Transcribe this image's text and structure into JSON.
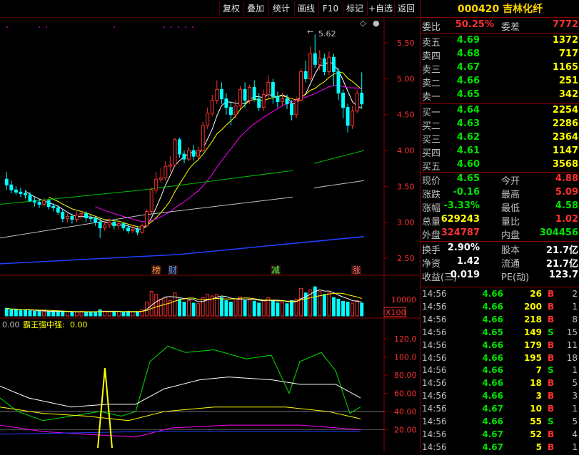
{
  "toolbar": {
    "buttons": [
      "复权",
      "叠加",
      "统计",
      "画线",
      "F10",
      "标记",
      "+自选",
      "返回"
    ]
  },
  "stock": {
    "code": "000420",
    "name": "吉林化纤"
  },
  "price_axis": [
    "5.50",
    "5.00",
    "4.50",
    "4.00",
    "3.50",
    "3.00",
    "2.50"
  ],
  "peak_label": "5.62",
  "event_markers": [
    "榜",
    "财",
    "减",
    "涨"
  ],
  "volume_axis": {
    "label": "10000",
    "unit": "X100"
  },
  "indicator": {
    "value_left": "0.00",
    "name": "霸王强中强:",
    "value": "0.00",
    "axis": [
      "120.0",
      "100.0",
      "80.00",
      "60.00",
      "40.00",
      "20.00"
    ]
  },
  "quote": {
    "weibi": {
      "label": "委比",
      "value": "50.25%",
      "label2": "委差",
      "value2": "7772"
    },
    "sell": [
      {
        "label": "卖五",
        "price": "4.69",
        "vol": "1372"
      },
      {
        "label": "卖四",
        "price": "4.68",
        "vol": "717"
      },
      {
        "label": "卖三",
        "price": "4.67",
        "vol": "1165"
      },
      {
        "label": "卖二",
        "price": "4.66",
        "vol": "251"
      },
      {
        "label": "卖一",
        "price": "4.65",
        "vol": "342"
      }
    ],
    "buy": [
      {
        "label": "买一",
        "price": "4.64",
        "vol": "2254"
      },
      {
        "label": "买二",
        "price": "4.63",
        "vol": "2286"
      },
      {
        "label": "买三",
        "price": "4.62",
        "vol": "2364"
      },
      {
        "label": "买四",
        "price": "4.61",
        "vol": "1147"
      },
      {
        "label": "买五",
        "price": "4.60",
        "vol": "3568"
      }
    ],
    "stats": [
      {
        "l1": "现价",
        "v1": "4.65",
        "c1": "green",
        "l2": "今开",
        "v2": "4.88",
        "c2": "red"
      },
      {
        "l1": "涨跌",
        "v1": "-0.16",
        "c1": "green",
        "l2": "最高",
        "v2": "5.09",
        "c2": "red"
      },
      {
        "l1": "涨幅",
        "v1": "-3.33%",
        "c1": "green",
        "l2": "最低",
        "v2": "4.58",
        "c2": "green"
      },
      {
        "l1": "总量",
        "v1": "629243",
        "c1": "yellow",
        "l2": "量比",
        "v2": "1.02",
        "c2": "red"
      },
      {
        "l1": "外盘",
        "v1": "324787",
        "c1": "red",
        "l2": "内盘",
        "v2": "304456",
        "c2": "green"
      }
    ],
    "stats2": [
      {
        "l1": "换手",
        "v1": "2.90%",
        "l2": "股本",
        "v2": "21.7亿"
      },
      {
        "l1": "净资",
        "v1": "1.42",
        "l2": "流通",
        "v2": "21.7亿"
      },
      {
        "l1": "收益(三)",
        "v1": "0.019",
        "l2": "PE(动)",
        "v2": "123.7"
      }
    ]
  },
  "trades": [
    {
      "time": "14:56",
      "price": "4.66",
      "vol": "26",
      "bs": "B",
      "n": "2"
    },
    {
      "time": "14:56",
      "price": "4.66",
      "vol": "200",
      "bs": "B",
      "n": "1"
    },
    {
      "time": "14:56",
      "price": "4.66",
      "vol": "218",
      "bs": "B",
      "n": "8"
    },
    {
      "time": "14:56",
      "price": "4.65",
      "vol": "149",
      "bs": "S",
      "n": "15"
    },
    {
      "time": "14:56",
      "price": "4.66",
      "vol": "179",
      "bs": "B",
      "n": "11"
    },
    {
      "time": "14:56",
      "price": "4.66",
      "vol": "195",
      "bs": "B",
      "n": "18"
    },
    {
      "time": "14:56",
      "price": "4.66",
      "vol": "7",
      "bs": "S",
      "n": "1"
    },
    {
      "time": "14:56",
      "price": "4.66",
      "vol": "18",
      "bs": "B",
      "n": "5"
    },
    {
      "time": "14:56",
      "price": "4.66",
      "vol": "3",
      "bs": "B",
      "n": "3"
    },
    {
      "time": "14:56",
      "price": "4.67",
      "vol": "10",
      "bs": "B",
      "n": "1"
    },
    {
      "time": "14:56",
      "price": "4.66",
      "vol": "55",
      "bs": "S",
      "n": "5"
    },
    {
      "time": "14:56",
      "price": "4.67",
      "vol": "52",
      "bs": "B",
      "n": "4"
    },
    {
      "time": "14:56",
      "price": "4.67",
      "vol": "5",
      "bs": "B",
      "n": "1"
    }
  ],
  "chart_data": {
    "type": "candlestick",
    "ylim": [
      2.3,
      5.8
    ],
    "candles": [
      [
        3.6,
        3.52,
        3.7,
        3.45
      ],
      [
        3.52,
        3.45,
        3.58,
        3.4
      ],
      [
        3.45,
        3.42,
        3.5,
        3.38
      ],
      [
        3.42,
        3.4,
        3.48,
        3.35
      ],
      [
        3.4,
        3.38,
        3.45,
        3.33
      ],
      [
        3.38,
        3.3,
        3.42,
        3.28
      ],
      [
        3.3,
        3.28,
        3.35,
        3.22
      ],
      [
        3.28,
        3.25,
        3.32,
        3.2
      ],
      [
        3.25,
        3.3,
        3.34,
        3.22
      ],
      [
        3.3,
        3.22,
        3.33,
        3.18
      ],
      [
        3.22,
        3.2,
        3.26,
        3.15
      ],
      [
        3.2,
        3.14,
        3.24,
        3.1
      ],
      [
        3.14,
        3.05,
        3.18,
        3.0
      ],
      [
        3.05,
        3.08,
        3.12,
        3.0
      ],
      [
        3.08,
        3.04,
        3.12,
        2.98
      ],
      [
        3.04,
        3.1,
        3.15,
        3.0
      ],
      [
        3.1,
        3.12,
        3.16,
        3.05
      ],
      [
        3.12,
        3.06,
        3.15,
        3.0
      ],
      [
        3.06,
        3.05,
        3.1,
        3.0
      ],
      [
        3.05,
        3.0,
        3.08,
        2.95
      ],
      [
        3.0,
        2.92,
        3.05,
        2.78
      ],
      [
        2.92,
        2.96,
        3.02,
        2.88
      ],
      [
        2.96,
        3.0,
        3.05,
        2.92
      ],
      [
        3.0,
        2.95,
        3.03,
        2.9
      ],
      [
        2.95,
        2.98,
        3.02,
        2.9
      ],
      [
        2.98,
        2.92,
        3.0,
        2.88
      ],
      [
        2.92,
        2.88,
        2.96,
        2.84
      ],
      [
        2.88,
        2.9,
        2.95,
        2.85
      ],
      [
        2.9,
        2.86,
        2.93,
        2.82
      ],
      [
        2.86,
        2.95,
        2.98,
        2.84
      ],
      [
        2.95,
        3.15,
        3.18,
        2.93
      ],
      [
        3.15,
        3.45,
        3.48,
        3.12
      ],
      [
        3.45,
        3.6,
        3.7,
        3.4
      ],
      [
        3.6,
        3.62,
        3.75,
        3.55
      ],
      [
        3.62,
        3.78,
        3.85,
        3.58
      ],
      [
        3.78,
        3.8,
        3.92,
        3.7
      ],
      [
        3.8,
        4.15,
        4.18,
        3.78
      ],
      [
        4.15,
        3.95,
        4.18,
        3.9
      ],
      [
        3.95,
        3.88,
        4.0,
        3.82
      ],
      [
        3.88,
        4.0,
        4.05,
        3.85
      ],
      [
        4.0,
        3.92,
        4.08,
        3.86
      ],
      [
        3.92,
        4.0,
        4.05,
        3.88
      ],
      [
        4.0,
        4.35,
        4.4,
        3.98
      ],
      [
        4.35,
        4.52,
        4.6,
        4.3
      ],
      [
        4.52,
        4.7,
        4.78,
        4.48
      ],
      [
        4.7,
        4.85,
        4.98,
        4.65
      ],
      [
        4.85,
        4.72,
        4.95,
        4.65
      ],
      [
        4.72,
        4.6,
        4.8,
        4.5
      ],
      [
        4.6,
        4.5,
        4.68,
        4.35
      ],
      [
        4.5,
        4.62,
        4.7,
        4.45
      ],
      [
        4.62,
        4.85,
        4.9,
        4.58
      ],
      [
        4.85,
        4.7,
        4.95,
        4.6
      ],
      [
        4.7,
        4.88,
        4.92,
        4.65
      ],
      [
        4.88,
        4.72,
        4.98,
        4.68
      ],
      [
        4.72,
        4.6,
        4.8,
        4.55
      ],
      [
        4.6,
        4.78,
        4.85,
        4.55
      ],
      [
        4.78,
        4.95,
        5.05,
        4.72
      ],
      [
        4.95,
        4.75,
        5.0,
        4.65
      ],
      [
        4.75,
        4.68,
        4.82,
        4.6
      ],
      [
        4.68,
        4.72,
        4.8,
        4.62
      ],
      [
        4.72,
        4.65,
        4.78,
        4.58
      ],
      [
        4.65,
        4.5,
        4.7,
        4.42
      ],
      [
        4.5,
        4.7,
        4.75,
        4.45
      ],
      [
        4.7,
        5.1,
        5.15,
        4.68
      ],
      [
        5.1,
        5.0,
        5.25,
        4.95
      ],
      [
        5.0,
        5.35,
        5.45,
        4.98
      ],
      [
        5.35,
        5.2,
        5.62,
        5.15
      ],
      [
        5.2,
        5.28,
        5.4,
        5.12
      ],
      [
        5.28,
        5.1,
        5.35,
        5.05
      ],
      [
        5.1,
        5.3,
        5.38,
        5.05
      ],
      [
        5.3,
        5.1,
        5.35,
        4.9
      ],
      [
        5.1,
        4.8,
        5.15,
        4.7
      ],
      [
        4.8,
        4.6,
        4.85,
        4.45
      ],
      [
        4.6,
        4.35,
        4.65,
        4.25
      ],
      [
        4.35,
        4.55,
        4.62,
        4.3
      ],
      [
        4.55,
        4.8,
        4.85,
        4.52
      ],
      [
        4.8,
        4.65,
        5.09,
        4.58
      ]
    ],
    "volumes": [
      0.25,
      0.2,
      0.22,
      0.18,
      0.2,
      0.17,
      0.15,
      0.16,
      0.15,
      0.14,
      0.16,
      0.15,
      0.13,
      0.14,
      0.12,
      0.13,
      0.15,
      0.12,
      0.13,
      0.14,
      0.2,
      0.16,
      0.14,
      0.13,
      0.14,
      0.12,
      0.15,
      0.13,
      0.14,
      0.2,
      0.45,
      0.8,
      0.7,
      0.55,
      0.6,
      0.5,
      0.75,
      0.55,
      0.45,
      0.5,
      0.42,
      0.4,
      0.6,
      0.7,
      0.65,
      0.7,
      0.6,
      0.5,
      0.45,
      0.55,
      0.62,
      0.5,
      0.55,
      0.48,
      0.42,
      0.5,
      0.6,
      0.5,
      0.42,
      0.45,
      0.4,
      0.5,
      0.55,
      0.9,
      0.75,
      0.85,
      0.95,
      0.8,
      0.7,
      0.75,
      0.6,
      0.55,
      0.48,
      0.45,
      0.42,
      0.5,
      0.42
    ]
  }
}
